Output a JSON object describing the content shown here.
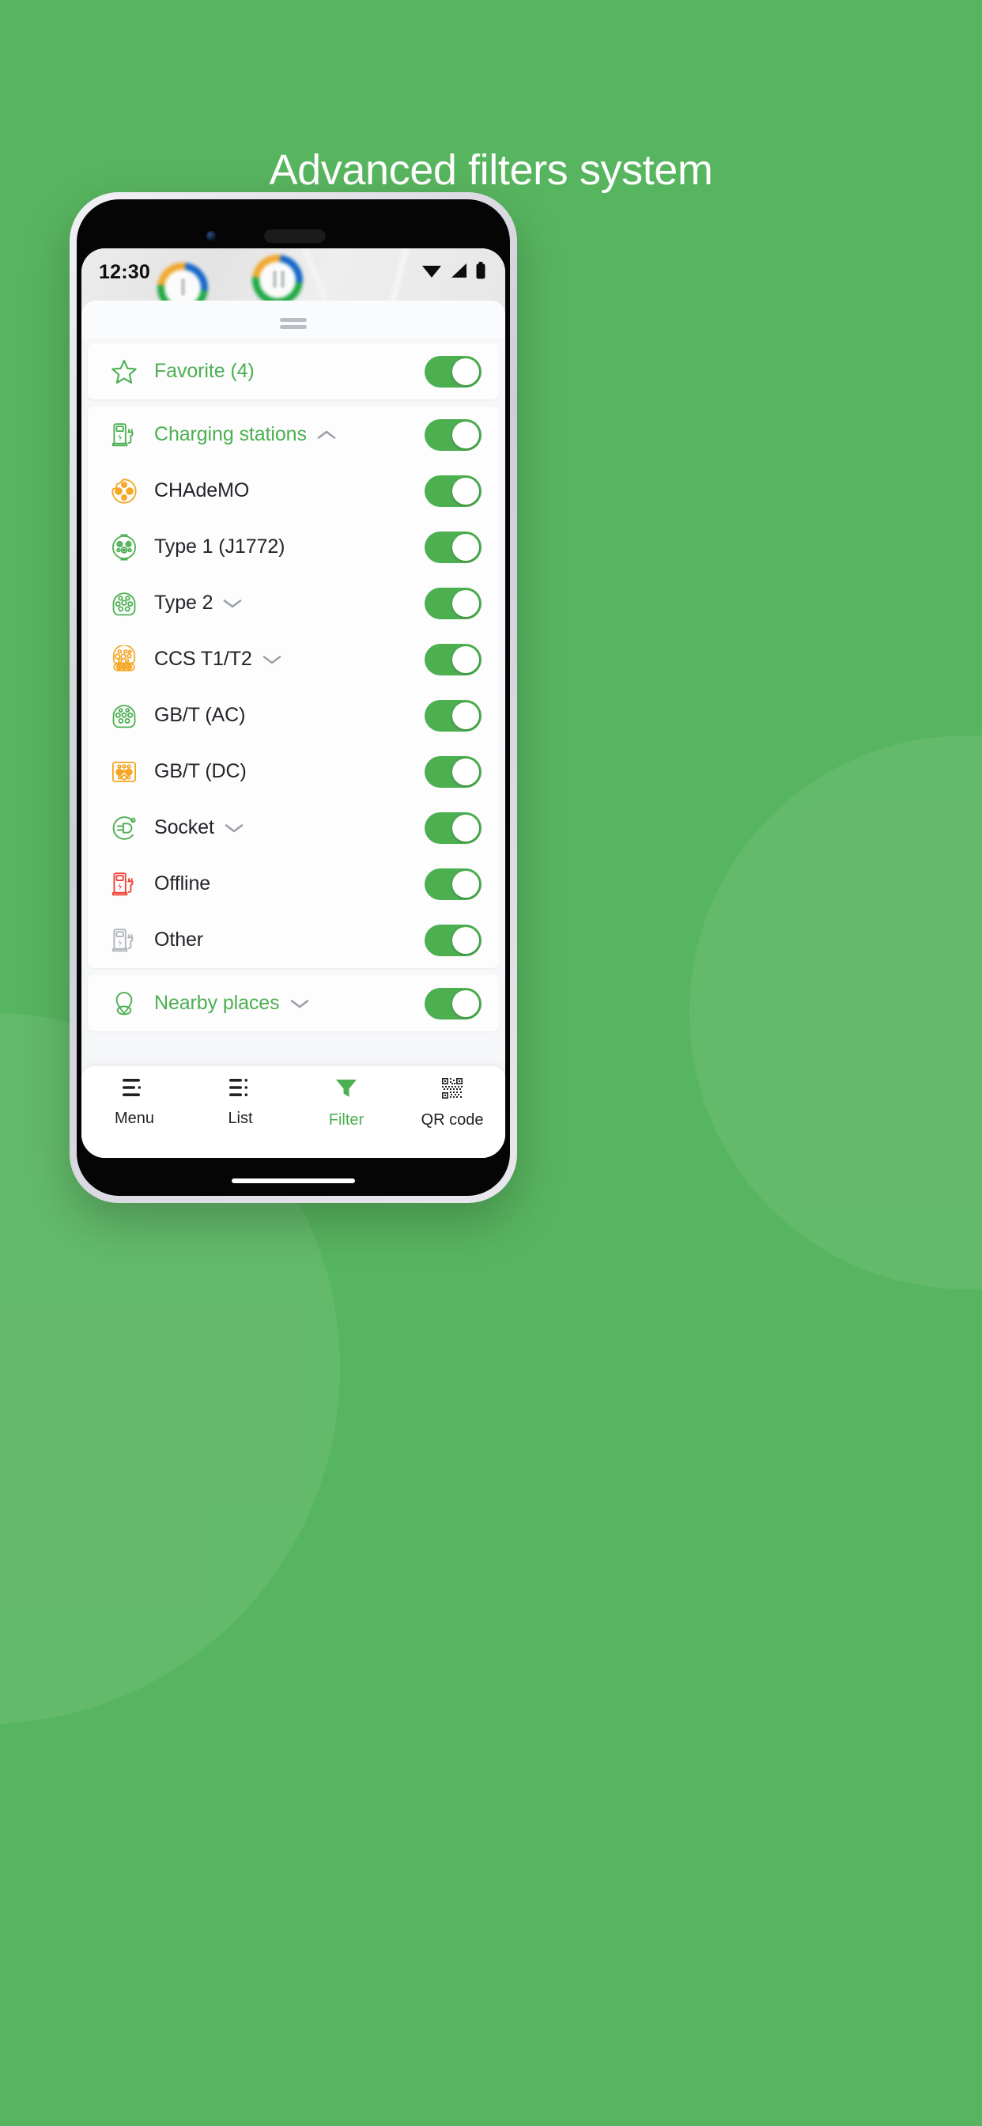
{
  "page": {
    "headline": "Advanced filters system",
    "background_color": "#58b55f"
  },
  "colors": {
    "brand_green": "#4caf50",
    "orange": "#f5a623",
    "red": "#ef4136",
    "gray": "#b0b4b8",
    "text_dark": "#222429"
  },
  "phone": {
    "statusbar": {
      "time": "12:30",
      "icons": [
        "wifi-icon",
        "cellular-signal-icon",
        "battery-icon"
      ]
    },
    "sheet": {
      "grip": "drag-handle",
      "groups": [
        {
          "id": "favorite",
          "rows": [
            {
              "label": "Favorite (4)",
              "icon": "star-outline-icon",
              "icon_color": "#4caf50",
              "label_color": "green",
              "chevron": "",
              "toggle": "on"
            }
          ]
        },
        {
          "id": "charging-stations",
          "rows": [
            {
              "label": "Charging stations",
              "icon": "charging-station-icon",
              "icon_color": "#4caf50",
              "label_color": "green",
              "chevron": "up",
              "toggle": "on"
            },
            {
              "label": "CHAdeMO",
              "icon": "chademo-connector-icon",
              "icon_color": "#f5a623",
              "label_color": "dark",
              "chevron": "",
              "toggle": "on"
            },
            {
              "label": "Type 1 (J1772)",
              "icon": "type1-connector-icon",
              "icon_color": "#4caf50",
              "label_color": "dark",
              "chevron": "",
              "toggle": "on"
            },
            {
              "label": "Type 2",
              "icon": "type2-connector-icon",
              "icon_color": "#4caf50",
              "label_color": "dark",
              "chevron": "down",
              "toggle": "on"
            },
            {
              "label": "CCS T1/T2",
              "icon": "ccs-connector-icon",
              "icon_color": "#f5a623",
              "label_color": "dark",
              "chevron": "down",
              "toggle": "on"
            },
            {
              "label": "GB/T (AC)",
              "icon": "gbt-ac-connector-icon",
              "icon_color": "#4caf50",
              "label_color": "dark",
              "chevron": "",
              "toggle": "on"
            },
            {
              "label": "GB/T (DC)",
              "icon": "gbt-dc-connector-icon",
              "icon_color": "#f5a623",
              "label_color": "dark",
              "chevron": "",
              "toggle": "on"
            },
            {
              "label": "Socket",
              "icon": "socket-plug-icon",
              "icon_color": "#4caf50",
              "label_color": "dark",
              "chevron": "down",
              "toggle": "on"
            },
            {
              "label": "Offline",
              "icon": "offline-station-icon",
              "icon_color": "#ef4136",
              "label_color": "dark",
              "chevron": "",
              "toggle": "on"
            },
            {
              "label": "Other",
              "icon": "other-station-icon",
              "icon_color": "#b0b4b8",
              "label_color": "dark",
              "chevron": "",
              "toggle": "on"
            }
          ]
        },
        {
          "id": "nearby-places",
          "rows": [
            {
              "label": "Nearby places",
              "icon": "map-pin-icon",
              "icon_color": "#4caf50",
              "label_color": "green",
              "chevron": "down",
              "toggle": "on"
            }
          ]
        }
      ]
    },
    "bottomnav": {
      "items": [
        {
          "label": "Menu",
          "icon": "menu-icon",
          "active": false
        },
        {
          "label": "List",
          "icon": "list-icon",
          "active": false
        },
        {
          "label": "Filter",
          "icon": "filter-funnel-icon",
          "active": true
        },
        {
          "label": "QR code",
          "icon": "qr-code-icon",
          "active": false
        }
      ]
    }
  }
}
